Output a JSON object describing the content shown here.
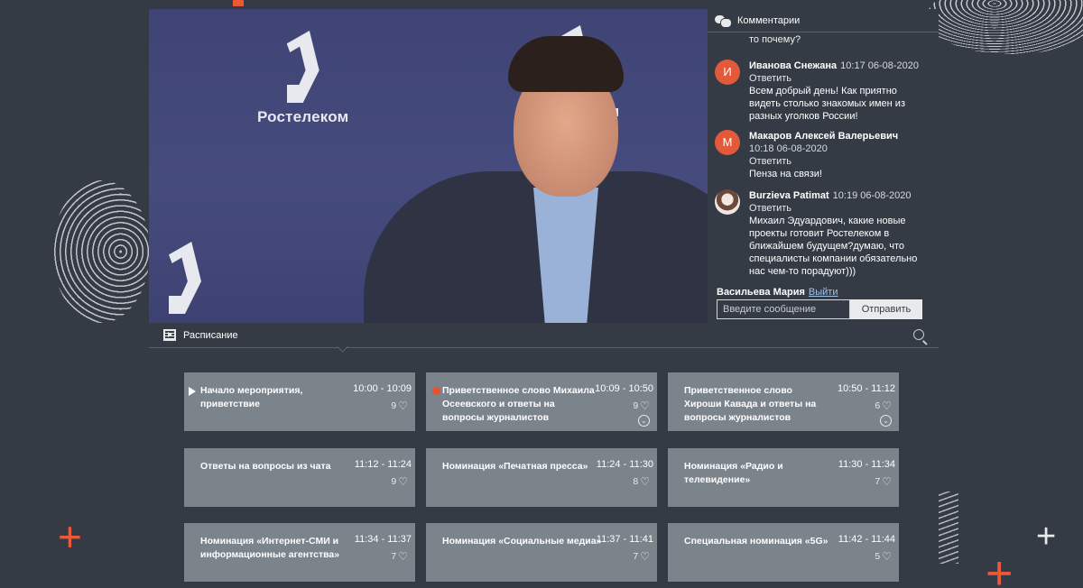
{
  "brand": {
    "name": "Ростелеком"
  },
  "comments": {
    "title": "Комментарии",
    "partial_text": "то почему?",
    "items": [
      {
        "initial": "И",
        "author": "Иванова Снежана",
        "time": "10:17 06-08-2020",
        "reply": "Ответить",
        "text": "Всем добрый день! Как приятно видеть столько знакомых имен из разных уголков России!"
      },
      {
        "initial": "М",
        "author": "Макаров Алексей Валерьевич",
        "time": "10:18 06-08-2020",
        "reply": "Ответить",
        "text": "Пенза на связи!"
      },
      {
        "initial": "",
        "author": "Burzieva Patimat",
        "time": "10:19 06-08-2020",
        "reply": "Ответить",
        "text": "Михаил Эдуардович, какие новые проекты готовит Ростелеком в ближайшем будущем?думаю, что специалисты компании обязательно нас чем-то порадуют)))"
      }
    ],
    "current_user": "Васильева Мария",
    "logout": "Выйти",
    "input_placeholder": "Введите сообщение",
    "send": "Отправить"
  },
  "schedule": {
    "title": "Расписание",
    "items": [
      {
        "title": "Начало мероприятия, приветствие",
        "time": "10:00 - 10:09",
        "likes": "9",
        "marker": "play"
      },
      {
        "title": "Приветственное слово Михаила Осеевского и ответы на вопросы журналистов",
        "time": "10:09 - 10:50",
        "likes": "9",
        "marker": "live"
      },
      {
        "title": "Приветственное слово Хироши Кавада и ответы на вопросы журналистов",
        "time": "10:50 - 11:12",
        "likes": "6",
        "marker": ""
      },
      {
        "title": "Ответы на вопросы из чата",
        "time": "11:12 - 11:24",
        "likes": "9",
        "marker": ""
      },
      {
        "title": "Номинация «Печатная пресса»",
        "time": "11:24 - 11:30",
        "likes": "8",
        "marker": ""
      },
      {
        "title": "Номинация «Радио и телевидение»",
        "time": "11:30 - 11:34",
        "likes": "7",
        "marker": ""
      },
      {
        "title": "Номинация «Интернет-СМИ и информационные агентства»",
        "time": "11:34 - 11:37",
        "likes": "7",
        "marker": ""
      },
      {
        "title": "Номинация «Социальные медиа»",
        "time": "11:37 - 11:41",
        "likes": "7",
        "marker": ""
      },
      {
        "title": "Специальная номинация «5G»",
        "time": "11:42 - 11:44",
        "likes": "5",
        "marker": ""
      }
    ]
  },
  "icons": {
    "comments": "chat-bubbles-icon",
    "schedule": "film-icon",
    "search": "search-icon",
    "like": "heart-icon",
    "expand": "chevron-down-circle-icon"
  },
  "colors": {
    "background": "#343b45",
    "accent": "#e8502f",
    "card": "#7b838b",
    "video_bg": "#434879"
  }
}
